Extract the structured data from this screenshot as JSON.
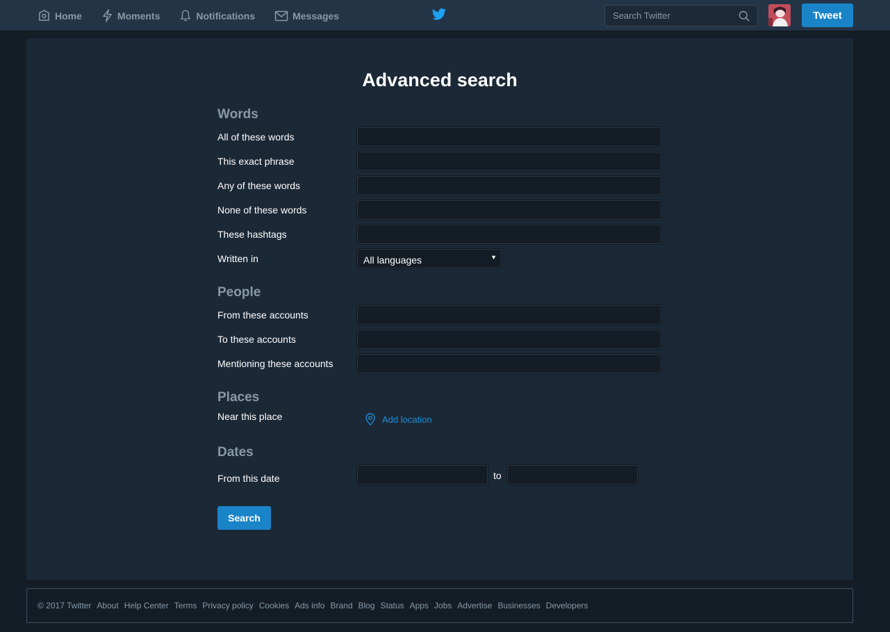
{
  "nav": {
    "items": [
      {
        "label": "Home",
        "icon": "home-icon"
      },
      {
        "label": "Moments",
        "icon": "lightning-icon"
      },
      {
        "label": "Notifications",
        "icon": "bell-icon"
      },
      {
        "label": "Messages",
        "icon": "envelope-icon"
      }
    ],
    "logo_icon": "twitter-bird-icon",
    "search_placeholder": "Search Twitter",
    "tweet_label": "Tweet"
  },
  "page": {
    "title": "Advanced search"
  },
  "sections": {
    "words": {
      "title": "Words",
      "fields": [
        {
          "label": "All of these words",
          "value": ""
        },
        {
          "label": "This exact phrase",
          "value": ""
        },
        {
          "label": "Any of these words",
          "value": ""
        },
        {
          "label": "None of these words",
          "value": ""
        },
        {
          "label": "These hashtags",
          "value": ""
        }
      ],
      "language_label": "Written in",
      "language_value": "All languages"
    },
    "people": {
      "title": "People",
      "fields": [
        {
          "label": "From these accounts",
          "value": ""
        },
        {
          "label": "To these accounts",
          "value": ""
        },
        {
          "label": "Mentioning these accounts",
          "value": ""
        }
      ]
    },
    "places": {
      "title": "Places",
      "label": "Near this place",
      "add_location": "Add location"
    },
    "dates": {
      "title": "Dates",
      "label": "From this date",
      "separator": "to",
      "from_value": "",
      "to_value": ""
    }
  },
  "search_button": "Search",
  "footer": {
    "copyright": "© 2017 Twitter",
    "links": [
      "About",
      "Help Center",
      "Terms",
      "Privacy policy",
      "Cookies",
      "Ads info",
      "Brand",
      "Blog",
      "Status",
      "Apps",
      "Jobs",
      "Advertise",
      "Businesses",
      "Developers"
    ]
  },
  "colors": {
    "accent": "#1da1f2",
    "button": "#1a84c9",
    "background": "#141d26",
    "panel": "#1b2836",
    "muted_text": "#8899a6"
  }
}
